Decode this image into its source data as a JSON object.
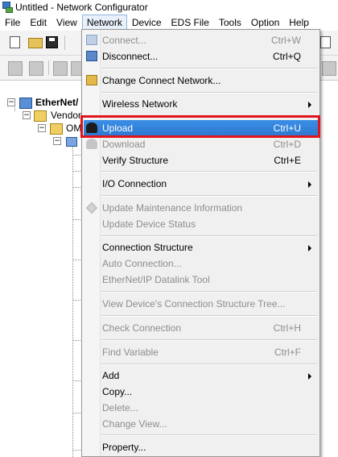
{
  "window": {
    "title": "Untitled - Network Configurator"
  },
  "menubar": {
    "items": [
      "File",
      "Edit",
      "View",
      "Network",
      "Device",
      "EDS File",
      "Tools",
      "Option",
      "Help"
    ]
  },
  "tree": {
    "root": "EtherNet/",
    "vendor": "Vendor",
    "device": "OM"
  },
  "network_menu": {
    "connect": {
      "label": "Connect...",
      "shortcut": "Ctrl+W"
    },
    "disconnect": {
      "label": "Disconnect...",
      "shortcut": "Ctrl+Q"
    },
    "change_connect_network": {
      "label": "Change Connect Network..."
    },
    "wireless_network": {
      "label": "Wireless Network"
    },
    "upload": {
      "label": "Upload",
      "shortcut": "Ctrl+U"
    },
    "download": {
      "label": "Download",
      "shortcut": "Ctrl+D"
    },
    "verify_structure": {
      "label": "Verify Structure",
      "shortcut": "Ctrl+E"
    },
    "io_connection": {
      "label": "I/O Connection"
    },
    "update_maintenance": {
      "label": "Update Maintenance Information"
    },
    "update_device_status": {
      "label": "Update Device Status"
    },
    "connection_structure": {
      "label": "Connection Structure"
    },
    "auto_connection": {
      "label": "Auto Connection..."
    },
    "datalink_tool": {
      "label": "EtherNet/IP Datalink Tool"
    },
    "view_connection_tree": {
      "label": "View Device's Connection Structure Tree..."
    },
    "check_connection": {
      "label": "Check Connection",
      "shortcut": "Ctrl+H"
    },
    "find_variable": {
      "label": "Find Variable",
      "shortcut": "Ctrl+F"
    },
    "add": {
      "label": "Add"
    },
    "copy": {
      "label": "Copy..."
    },
    "delete": {
      "label": "Delete..."
    },
    "change_view": {
      "label": "Change View..."
    },
    "property": {
      "label": "Property..."
    }
  },
  "colors": {
    "highlight": "#2d78d0",
    "callout_border": "#e0141b",
    "menu_background": "#f0f0f0"
  }
}
